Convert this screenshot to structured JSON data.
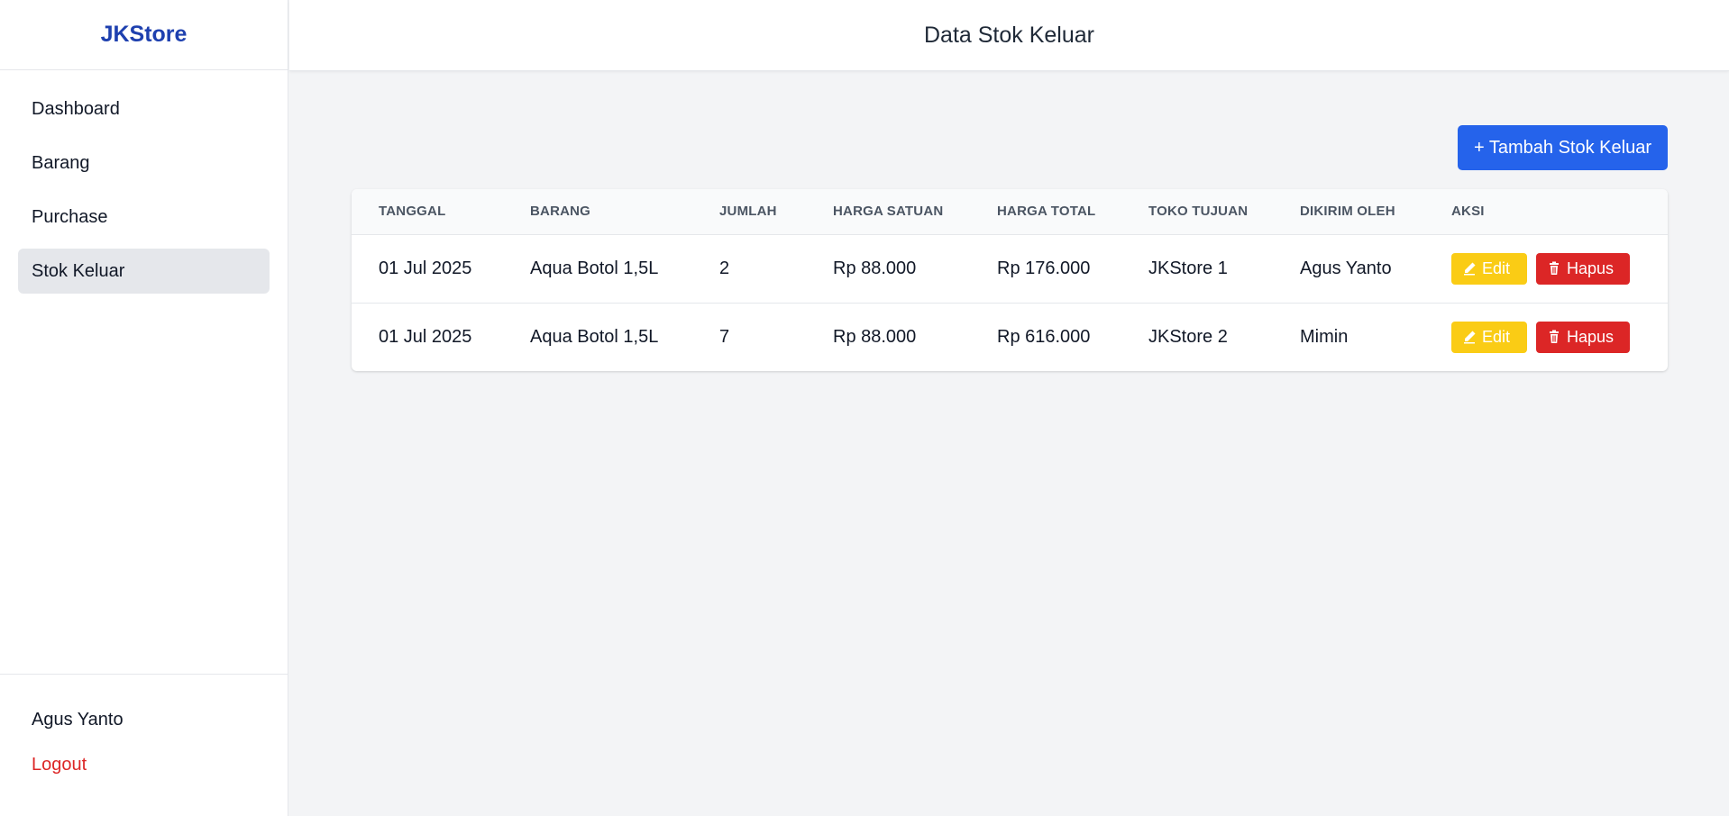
{
  "sidebar": {
    "brand": "JKStore",
    "items": [
      {
        "label": "Dashboard"
      },
      {
        "label": "Barang"
      },
      {
        "label": "Purchase"
      },
      {
        "label": "Stok Keluar",
        "active": true
      }
    ],
    "user_name": "Agus Yanto",
    "logout_label": "Logout"
  },
  "header": {
    "title": "Data Stok Keluar"
  },
  "toolbar": {
    "add_label": "+ Tambah Stok Keluar"
  },
  "table": {
    "columns": [
      "Tanggal",
      "Barang",
      "Jumlah",
      "Harga Satuan",
      "Harga Total",
      "Toko Tujuan",
      "Dikirim Oleh",
      "Aksi"
    ],
    "rows": [
      {
        "tanggal": "01 Jul 2025",
        "barang": "Aqua Botol 1,5L",
        "jumlah": "2",
        "harga_satuan": "Rp 88.000",
        "harga_total": "Rp 176.000",
        "toko_tujuan": "JKStore 1",
        "dikirim_oleh": "Agus Yanto",
        "edit_label": "Edit",
        "delete_label": "Hapus"
      },
      {
        "tanggal": "01 Jul 2025",
        "barang": "Aqua Botol 1,5L",
        "jumlah": "7",
        "harga_satuan": "Rp 88.000",
        "harga_total": "Rp 616.000",
        "toko_tujuan": "JKStore 2",
        "dikirim_oleh": "Mimin",
        "edit_label": "Edit",
        "delete_label": "Hapus"
      }
    ]
  },
  "colors": {
    "brand": "#1e40af",
    "primary": "#2563eb",
    "edit": "#facc15",
    "danger": "#dc2626",
    "background": "#f3f4f6"
  }
}
